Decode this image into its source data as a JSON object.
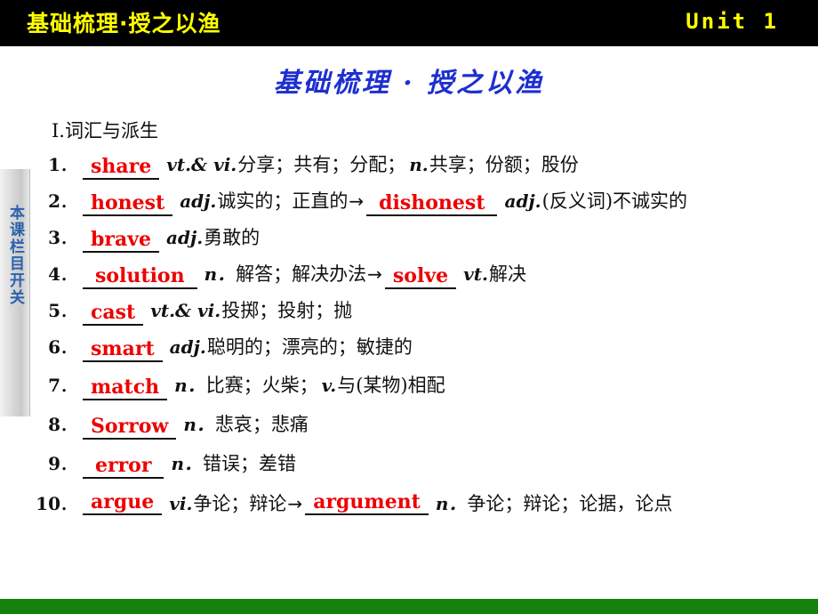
{
  "header": {
    "title": "基础梳理·授之以渔",
    "unit": "Unit 1"
  },
  "side_tab": {
    "label": "本课栏目开关"
  },
  "slide": {
    "title": "基础梳理 · 授之以渔",
    "section_heading": "Ⅰ.词汇与派生"
  },
  "colors": {
    "header_bg": "#000000",
    "header_text": "#ffff00",
    "title_blue": "#1d2fd0",
    "answer_red": "#ee0000",
    "footer_green": "#16820e",
    "side_tab_text": "#2a62ad"
  },
  "vocab": [
    {
      "num": "1",
      "dot": "．",
      "answer": "share",
      "pos": "vt.& vi.",
      "def": "分享；共有；分配；",
      "pos2": "n.",
      "def2": "共享；份额；股份"
    },
    {
      "num": "2",
      "dot": "．",
      "answer": "honest",
      "pos": "adj.",
      "def": "诚实的；正直的",
      "arrow": "→",
      "answer2": "dishonest",
      "pos2": "adj.",
      "def2": "(反义词)不诚实的"
    },
    {
      "num": "3",
      "dot": "．",
      "answer": "brave",
      "pos": "adj.",
      "def": "勇敢的"
    },
    {
      "num": "4",
      "dot": "．",
      "answer": "solution",
      "pos": "n．",
      "def": "解答；解决办法",
      "arrow": "→",
      "answer2": "solve",
      "pos2": "vt.",
      "def2": "解决"
    },
    {
      "num": "5",
      "dot": "．",
      "answer": "cast",
      "pos": "vt.& vi.",
      "def": "投掷；投射；抛"
    },
    {
      "num": "6",
      "dot": "．",
      "answer": "smart",
      "pos": "adj.",
      "def": "聪明的；漂亮的；敏捷的"
    },
    {
      "num": "7",
      "dot": "．",
      "answer": "match",
      "pos": "n．",
      "def": "比赛；火柴；",
      "pos2": "v.",
      "def2": "与(某物)相配"
    },
    {
      "num": "8",
      "dot": "．",
      "answer": "Sorrow",
      "pos": "n．",
      "def": "悲哀；悲痛"
    },
    {
      "num": "9",
      "dot": "．",
      "answer": "error",
      "pos": "n．",
      "def": "错误；差错"
    },
    {
      "num": "10",
      "dot": "．",
      "answer": "argue",
      "pos": "vi.",
      "def": "争论；辩论",
      "arrow": "→",
      "answer2": "argument",
      "pos2": "n．",
      "def2": "争论；辩论；论据，论点"
    }
  ],
  "footer": {}
}
